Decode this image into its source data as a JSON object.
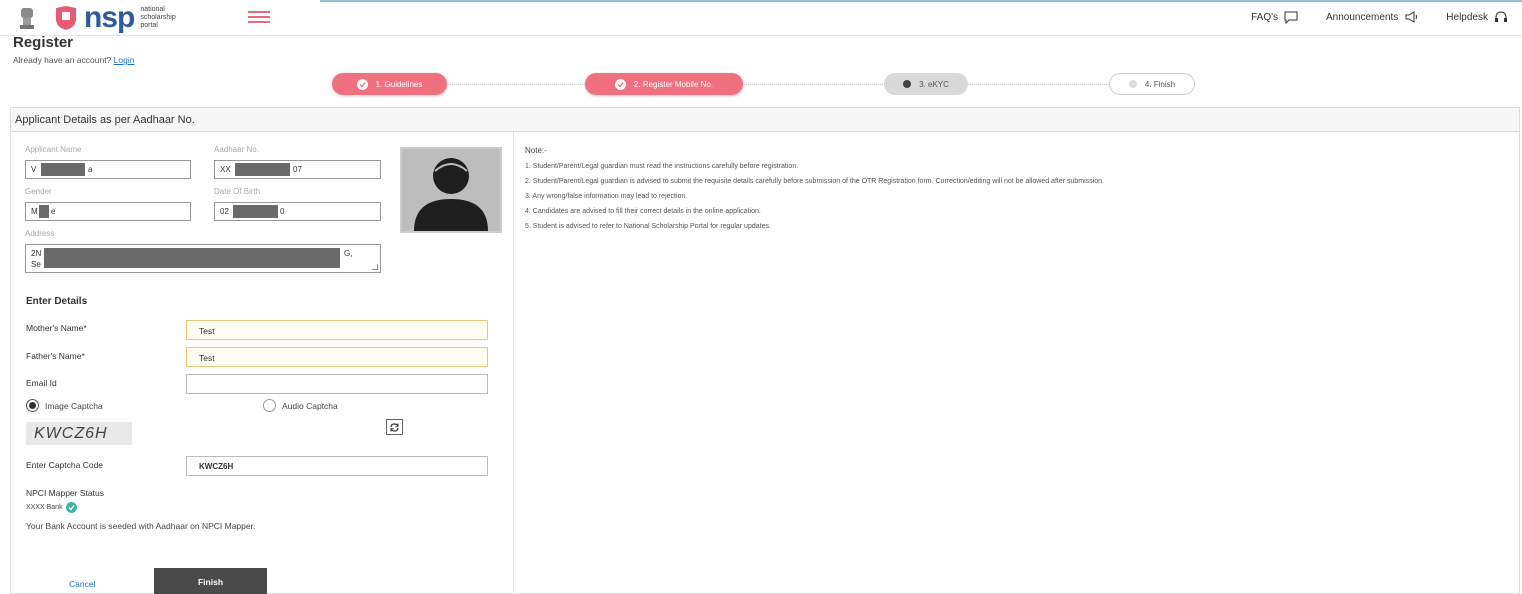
{
  "header": {
    "brand": "nsp",
    "brand_sub": "national scholarship portal",
    "links": {
      "faq": "FAQ's",
      "announcements": "Announcements",
      "helpdesk": "Helpdesk"
    }
  },
  "page": {
    "title": "Register",
    "have_account": "Already have an account?",
    "login": "Login"
  },
  "stepper": {
    "steps": [
      {
        "label": "1. Guidelines",
        "state": "done"
      },
      {
        "label": "2. Register Mobile No.",
        "state": "done"
      },
      {
        "label": "3. eKYC",
        "state": "current"
      },
      {
        "label": "4. Finish",
        "state": "pending"
      }
    ]
  },
  "applicant": {
    "panel_title": "Applicant Details as per Aadhaar No.",
    "name_label": "Applicant Name",
    "name_value_start": "V",
    "name_value_end": "a",
    "aadhaar_label": "Aadhaar No.",
    "aadhaar_value_start": "XX",
    "aadhaar_value_end": "07",
    "gender_label": "Gender",
    "gender_value_start": "M",
    "gender_value_end": "e",
    "dob_label": "Date Of Birth",
    "dob_value_start": "02",
    "dob_value_end": "0",
    "address_label": "Address",
    "address_line1_start": "2N",
    "address_line1_end": "G,",
    "address_line2_start": "Se"
  },
  "enter_details": {
    "title": "Enter Details",
    "mother_label": "Mother's Name*",
    "mother_value": "Test",
    "father_label": "Father's Name*",
    "father_value": "Test",
    "email_label": "Email Id",
    "email_value": "",
    "image_captcha": "Image Captcha",
    "audio_captcha": "Audio Captcha",
    "captcha_text": "KWCZ6H",
    "captcha_code_label": "Enter Captcha Code",
    "captcha_code_value": "KWCZ6H",
    "npci_title": "NPCI Mapper Status",
    "bank_name": "XXXX Bank",
    "seeded_msg": "Your Bank Account is seeded with Aadhaar on NPCI Mapper.",
    "cancel": "Cancel",
    "finish": "Finish"
  },
  "notes": {
    "title": "Note:-",
    "items": [
      "1. Student/Parent/Legal guardian must read the instructions carefully before registration.",
      "2. Student/Parent/Legal guardian is advised to submit the requisite details carefully before submission of the OTR Registration form. Correction/editing will not be allowed after submission.",
      "3. Any wrong/false information may lead to rejection.",
      "4. Candidates are advised to fill their correct details in the online application.",
      "5. Student is advised to refer to National Scholarship Portal for regular updates."
    ]
  },
  "colors": {
    "step_done": "#f07080",
    "brand_blue": "#2f5b9c",
    "link_blue": "#1a73c9",
    "finish_button": "#4a4a4a"
  }
}
